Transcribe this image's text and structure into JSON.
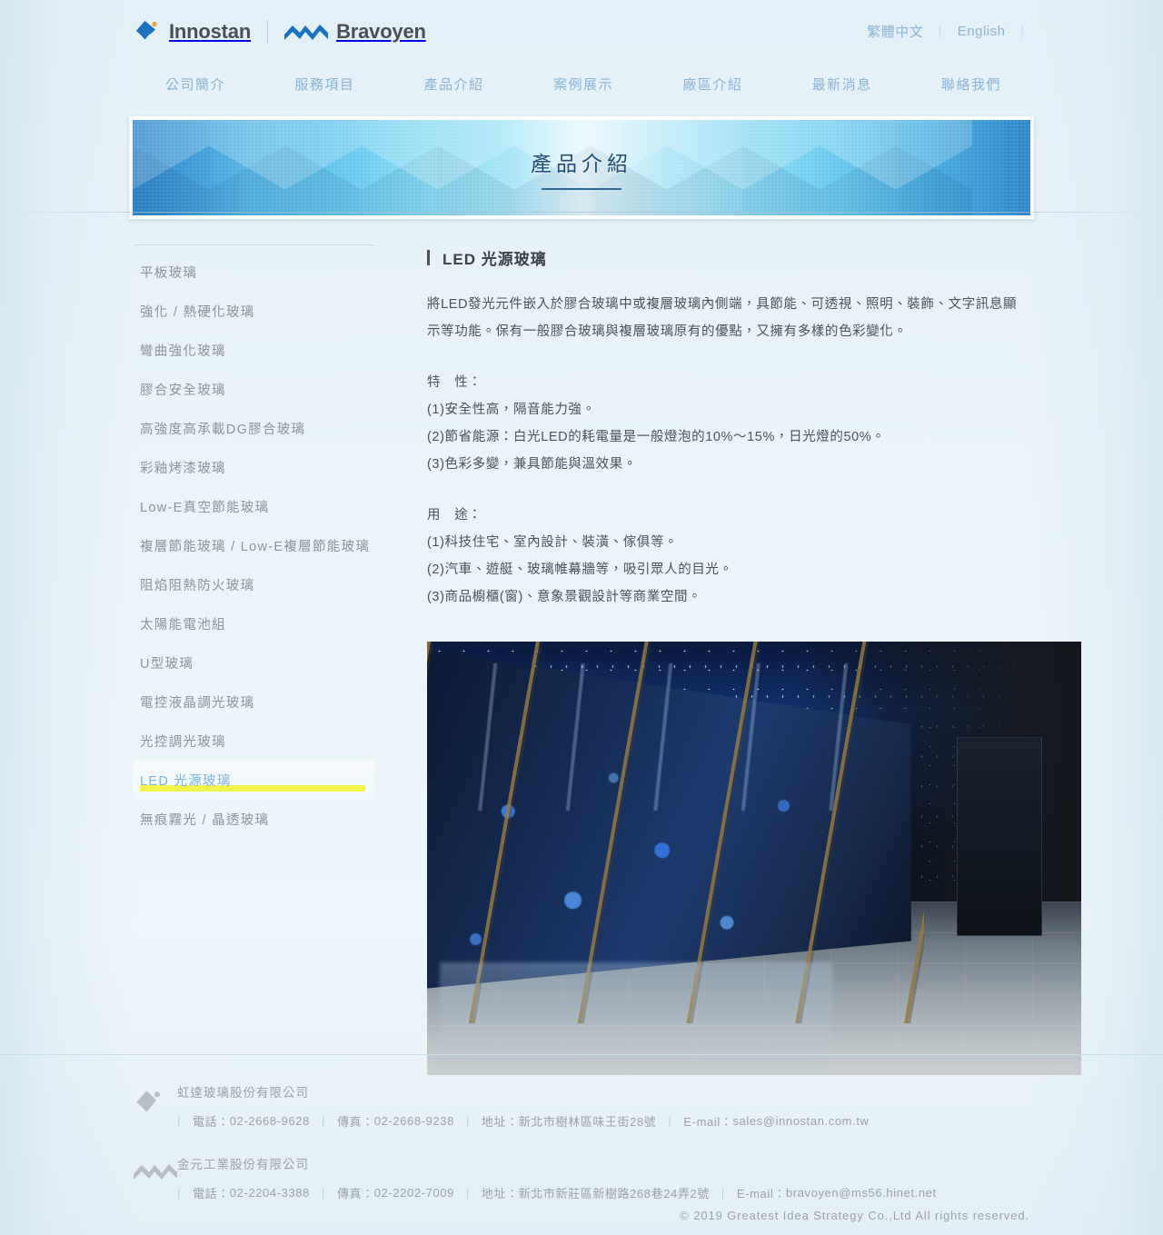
{
  "header": {
    "brands": [
      {
        "name": "Innostan",
        "logo_icon": "innostan-diamond-logo"
      },
      {
        "name": "Bravoyen",
        "logo_icon": "bravoyen-zigzag-logo"
      }
    ],
    "languages": [
      {
        "label": "繁體中文"
      },
      {
        "label": "English"
      }
    ],
    "lang_separator": "｜"
  },
  "nav": {
    "items": [
      {
        "label": "公司簡介"
      },
      {
        "label": "服務項目"
      },
      {
        "label": "產品介紹"
      },
      {
        "label": "案例展示"
      },
      {
        "label": "廠區介紹"
      },
      {
        "label": "最新消息"
      },
      {
        "label": "聯絡我們"
      }
    ]
  },
  "banner": {
    "title": "產品介紹"
  },
  "sidebar": {
    "items": [
      {
        "label": "平板玻璃",
        "active": false
      },
      {
        "label": "強化 / 熱硬化玻璃",
        "active": false
      },
      {
        "label": "彎曲強化玻璃",
        "active": false
      },
      {
        "label": "膠合安全玻璃",
        "active": false
      },
      {
        "label": "高強度高承載DG膠合玻璃",
        "active": false
      },
      {
        "label": "彩釉烤漆玻璃",
        "active": false
      },
      {
        "label": "Low-E真空節能玻璃",
        "active": false
      },
      {
        "label": "複層節能玻璃 / Low-E複層節能玻璃",
        "active": false
      },
      {
        "label": "阻焰阻熱防火玻璃",
        "active": false
      },
      {
        "label": "太陽能電池組",
        "active": false
      },
      {
        "label": "U型玻璃",
        "active": false
      },
      {
        "label": "電控液晶調光玻璃",
        "active": false
      },
      {
        "label": "光控調光玻璃",
        "active": false
      },
      {
        "label": "LED 光源玻璃",
        "active": true
      },
      {
        "label": "無痕霧光 / 晶透玻璃",
        "active": false
      }
    ]
  },
  "content": {
    "title": "LED 光源玻璃",
    "intro": "將LED發光元件嵌入於膠合玻璃中或複層玻璃內側端，具節能、可透視、照明、裝飾、文字訊息顯示等功能。保有一般膠合玻璃與複層玻璃原有的優點，又擁有多樣的色彩變化。",
    "features": {
      "heading": "特　性：",
      "lines": [
        "(1)安全性高，隔音能力強。",
        "(2)節省能源：白光LED的耗電量是一般燈泡的10%～15%，日光燈的50%。",
        "(3)色彩多變，兼具節能與溫效果。"
      ]
    },
    "uses": {
      "heading": "用　途：",
      "lines": [
        "(1)科技住宅、室內設計、裝潢、傢俱等。",
        "(2)汽車、遊艇、玻璃帷幕牆等，吸引眾人的目光。",
        "(3)商品櫥櫃(窗)、意象景觀設計等商業空間。"
      ]
    },
    "image_alt": "LED 光源玻璃應用於商場走道玻璃隔間"
  },
  "footer": {
    "companies": [
      {
        "logo_icon": "innostan-diamond-logo-gray",
        "name": "虹達玻璃股份有限公司",
        "phone_label": "電話：",
        "phone": "02-2668-9628",
        "fax_label": "傳真：",
        "fax": "02-2668-9238",
        "address_label": "地址：",
        "address": "新北市樹林區味王街28號",
        "email_label": "E-mail：",
        "email": "sales@innostan.com.tw"
      },
      {
        "logo_icon": "bravoyen-zigzag-logo-gray",
        "name": "金元工業股份有限公司",
        "phone_label": "電話：",
        "phone": "02-2204-3388",
        "fax_label": "傳真：",
        "fax": "02-2202-7009",
        "address_label": "地址：",
        "address": "新北市新莊區新樹路268巷24弄2號",
        "email_label": "E-mail：",
        "email": "bravoyen@ms56.hinet.net"
      }
    ],
    "copyright": "© 2019 Greatest Idea Strategy Co.,Ltd All rights reserved."
  },
  "colors": {
    "brand_blue": "#1a72c0",
    "nav_link": "#8ab3d4",
    "active_highlight": "#f2f24a",
    "banner_dark": "#2f86c9",
    "banner_light": "#e8f8fd",
    "page_bg": "#eaf4f9",
    "text": "#4c5256",
    "muted": "#9aa3a9"
  }
}
